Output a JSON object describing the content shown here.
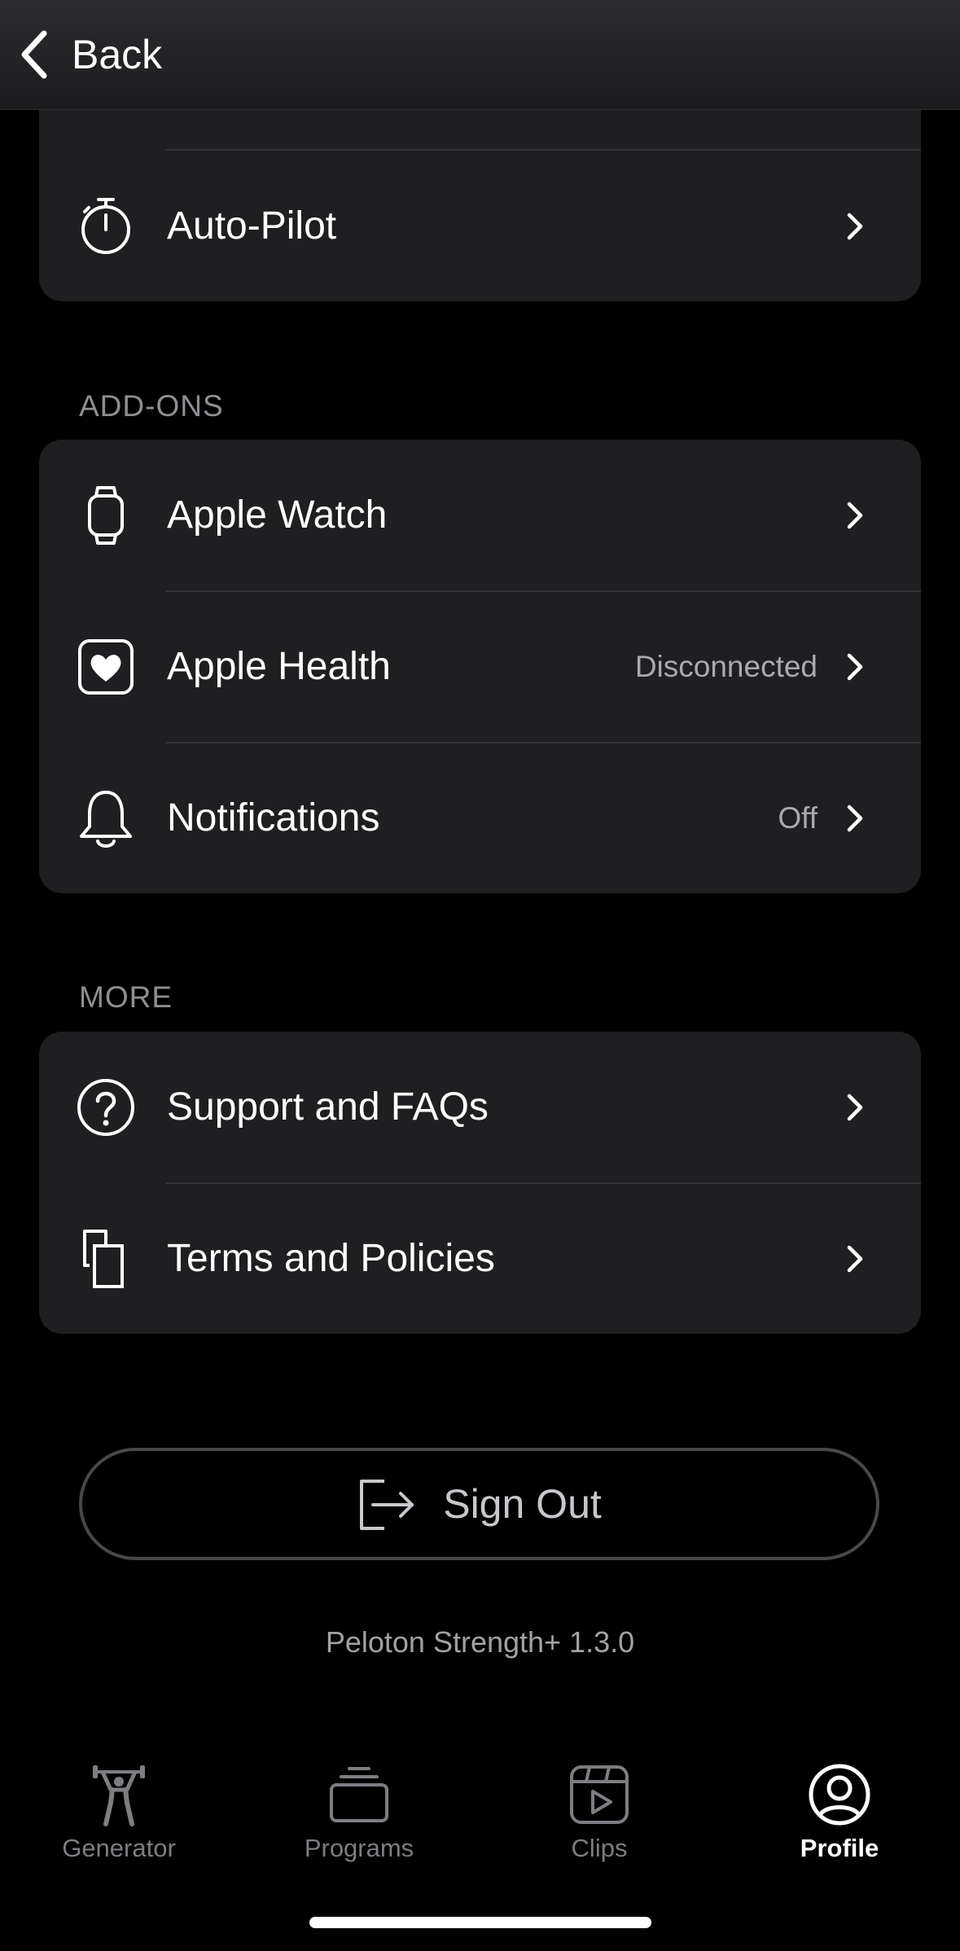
{
  "header": {
    "back_label": "Back"
  },
  "top_card": {
    "items": [
      {
        "label": "Auto-Pilot",
        "icon": "stopwatch-icon"
      }
    ]
  },
  "addons": {
    "title": "ADD-ONS",
    "items": [
      {
        "label": "Apple Watch",
        "icon": "watch-icon",
        "value": ""
      },
      {
        "label": "Apple Health",
        "icon": "heart-icon",
        "value": "Disconnected"
      },
      {
        "label": "Notifications",
        "icon": "bell-icon",
        "value": "Off"
      }
    ]
  },
  "more": {
    "title": "MORE",
    "items": [
      {
        "label": "Support and FAQs",
        "icon": "question-icon"
      },
      {
        "label": "Terms and Policies",
        "icon": "documents-icon"
      }
    ]
  },
  "sign_out_label": "Sign Out",
  "version": "Peloton Strength+ 1.3.0",
  "tabs": [
    {
      "label": "Generator",
      "icon": "weightlifter-icon",
      "active": false
    },
    {
      "label": "Programs",
      "icon": "stack-icon",
      "active": false
    },
    {
      "label": "Clips",
      "icon": "clips-icon",
      "active": false
    },
    {
      "label": "Profile",
      "icon": "profile-icon",
      "active": true
    }
  ],
  "colors": {
    "background": "#000000",
    "card": "#1f1f21",
    "text": "#ffffff",
    "secondary_text": "#a9a9ae",
    "inactive_tab": "#7d7d82"
  }
}
